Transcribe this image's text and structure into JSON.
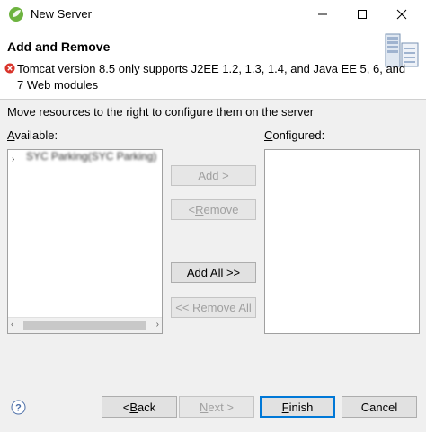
{
  "window": {
    "title": "New Server"
  },
  "header": {
    "title": "Add and Remove",
    "error_message": "Tomcat version 8.5 only supports J2EE 1.2, 1.3, 1.4, and Java EE 5, 6, and 7 Web modules"
  },
  "main": {
    "instruction": "Move resources to the right to configure them on the server",
    "available_prefix": "A",
    "available_rest": "vailable:",
    "configured_prefix": "C",
    "configured_rest": "onfigured:",
    "available_items": [
      {
        "label": "SYC Parking(SYC Parking)"
      }
    ]
  },
  "buttons": {
    "add_pre": "",
    "add_u": "A",
    "add_post": "dd >",
    "remove_pre": "< ",
    "remove_u": "R",
    "remove_post": "emove",
    "addall_pre": "Add A",
    "addall_u": "l",
    "addall_post": "l >>",
    "removeall_pre": "<< Re",
    "removeall_u": "m",
    "removeall_post": "ove All"
  },
  "footer": {
    "back_pre": "< ",
    "back_u": "B",
    "back_post": "ack",
    "next_pre": "",
    "next_u": "N",
    "next_post": "ext >",
    "finish_pre": "",
    "finish_u": "F",
    "finish_post": "inish",
    "cancel": "Cancel"
  },
  "icons": {
    "app": "spring-leaf-icon",
    "error": "error-icon",
    "help": "help-icon",
    "header": "server-wizard-graphic"
  },
  "colors": {
    "accent": "#0078d7",
    "error": "#d9342b",
    "leaf": "#6db33f"
  }
}
